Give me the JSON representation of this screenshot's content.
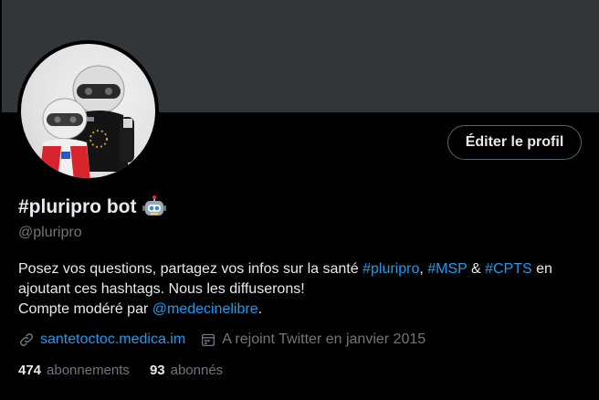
{
  "profile": {
    "display_name": "#pluripro bot",
    "handle": "@pluripro",
    "edit_button": "Éditer le profil",
    "avatar_emoji": "robot-icon"
  },
  "bio": {
    "text1": "Posez vos questions, partagez vos infos sur la santé ",
    "tag1": "#pluripro",
    "sep1": ", ",
    "tag2": "#MSP",
    "sep2": " & ",
    "tag3": "#CPTS",
    "text2": " en ajoutant ces hashtags. Nous les diffuserons!",
    "text3": "Compte modéré par ",
    "mention": "@medecinelibre",
    "text4": "."
  },
  "meta": {
    "url": "santetoctoc.medica.im",
    "joined": "A rejoint Twitter en janvier 2015"
  },
  "stats": {
    "following_count": "474",
    "following_label": "abonnements",
    "followers_count": "93",
    "followers_label": "abonnés"
  },
  "colors": {
    "link": "#1d9bf0",
    "muted": "#71767b",
    "text": "#e7e9ea",
    "banner": "#333639"
  }
}
